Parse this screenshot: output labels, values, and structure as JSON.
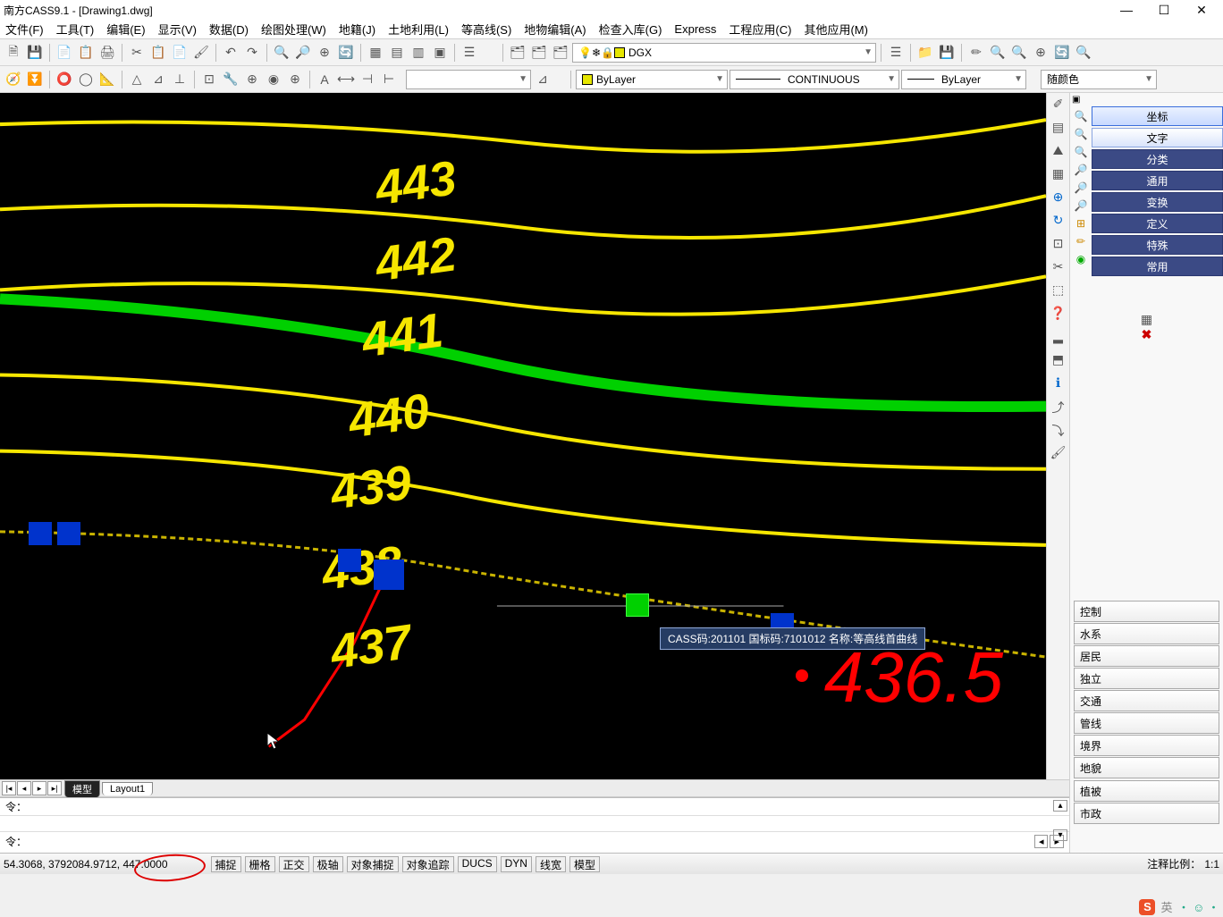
{
  "title": "南方CASS9.1 - [Drawing1.dwg]",
  "window_buttons": {
    "min": "—",
    "max": "☐",
    "close": "✕"
  },
  "menu": [
    "文件(F)",
    "工具(T)",
    "编辑(E)",
    "显示(V)",
    "数据(D)",
    "绘图处理(W)",
    "地籍(J)",
    "土地利用(L)",
    "等高线(S)",
    "地物编辑(A)",
    "检查入库(G)",
    "Express",
    "工程应用(C)",
    "其他应用(M)"
  ],
  "toolbar1_icons": [
    "🗎",
    "💾",
    "📄",
    "📋",
    "🖨",
    "✂",
    "📋",
    "📄",
    "🖌",
    "↶",
    "↷",
    "🔍",
    "🔎",
    "⊕",
    "🔄",
    "▦",
    "▤",
    "▥",
    "▣",
    "☰",
    "🗂",
    "🗂",
    "🗂",
    "💡",
    "❄",
    "🔒",
    "⬜"
  ],
  "layer_dropdown": "DGX",
  "layer_sw_color": "#e6e600",
  "toolbar2_icons": [
    "🧭",
    "⏬",
    "⭕",
    "◯",
    "📐",
    "△",
    "⊿",
    "⊥",
    "⊡",
    "🔧",
    "⊕",
    "◉",
    "⊕",
    "A",
    "⟷",
    "⊣",
    "⊢"
  ],
  "prop_layer": "ByLayer",
  "prop_linetype": "CONTINUOUS",
  "prop_lineweight": "ByLayer",
  "prop_color": "随颜色",
  "contour_labels": [
    "443",
    "442",
    "441",
    "440",
    "439",
    "438",
    "437"
  ],
  "red_label": "436.5",
  "tooltip": "CASS码:201101 国标码:7101012 名称:等高线首曲线",
  "right_tool_icons": [
    "✐",
    "▤",
    "⛰",
    "▦",
    "⊕",
    "↻",
    "⊡",
    "✂",
    "⬚",
    "❓",
    "▂",
    "⬒",
    "ℹ",
    "⤴",
    "⤵",
    "✖"
  ],
  "right_panel_top": [
    "坐标",
    "文字"
  ],
  "right_panel_dark": [
    "分类",
    "通用",
    "变换",
    "定义",
    "特殊",
    "常用"
  ],
  "right_panel_icons": [
    "🔍",
    "🔍",
    "🔍",
    "🔎",
    "🔎",
    "🔎",
    "⊞",
    "✏",
    "◉"
  ],
  "right_panel_bottom": [
    "控制",
    "水系",
    "居民",
    "独立",
    "交通",
    "管线",
    "境界",
    "地貌",
    "植被",
    "市政"
  ],
  "tabs": {
    "active": "模型",
    "others": [
      "Layout1"
    ]
  },
  "cmd_prompt": "令：",
  "status": {
    "coords": "54.3068, 3792084.9712, 447.0000",
    "z_val": "447.0000",
    "buttons": [
      "捕捉",
      "栅格",
      "正交",
      "极轴",
      "对象捕捉",
      "对象追踪",
      "DUCS",
      "DYN",
      "线宽",
      "模型"
    ],
    "scale_label": "注释比例：",
    "scale_value": "1:1"
  },
  "ime": {
    "logo": "S",
    "lang": "英",
    "icons": "・ ☺ ・"
  }
}
